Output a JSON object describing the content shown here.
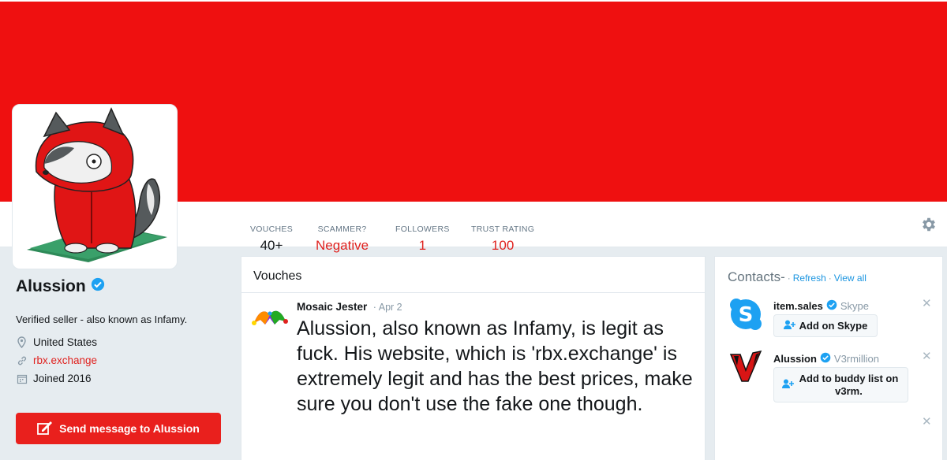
{
  "profile": {
    "name": "Alussion",
    "bio": "Verified seller - also known as Infamy.",
    "location": "United States",
    "website": "rbx.exchange",
    "joined": "Joined 2016",
    "send_message_label": "Send message to Alussion"
  },
  "stats": [
    {
      "label": "VOUCHES",
      "value": "40+"
    },
    {
      "label": "SCAMMER?",
      "value": "Negative"
    },
    {
      "label": "FOLLOWERS",
      "value": "1"
    },
    {
      "label": "TRUST RATING",
      "value": "100"
    }
  ],
  "vouches": {
    "title": "Vouches",
    "items": [
      {
        "author": "Mosaic Jester",
        "date": "Apr 2",
        "text": "Alussion, also known as Infamy, is legit as fuck. His website, which is 'rbx.exchange' is extremely legit and has the best prices, make sure you don't use the fake one though."
      }
    ]
  },
  "contacts": {
    "title": "Contacts-",
    "refresh_label": "Refresh",
    "view_all_label": "View all",
    "items": [
      {
        "name": "item.sales",
        "service": "Skype",
        "button": "Add on Skype"
      },
      {
        "name": "Alussion",
        "service": "V3rmillion",
        "button": "Add to buddy list on v3rm."
      }
    ]
  },
  "colors": {
    "accent": "#e0221f",
    "banner": "#ef1010",
    "verified": "#1da1f2",
    "link": "#1b95e0"
  },
  "icons": [
    "gear-icon",
    "verified-icon",
    "location-icon",
    "link-icon",
    "calendar-icon",
    "compose-icon",
    "skype-icon",
    "v3rmillion-icon",
    "add-user-icon",
    "close-icon"
  ]
}
